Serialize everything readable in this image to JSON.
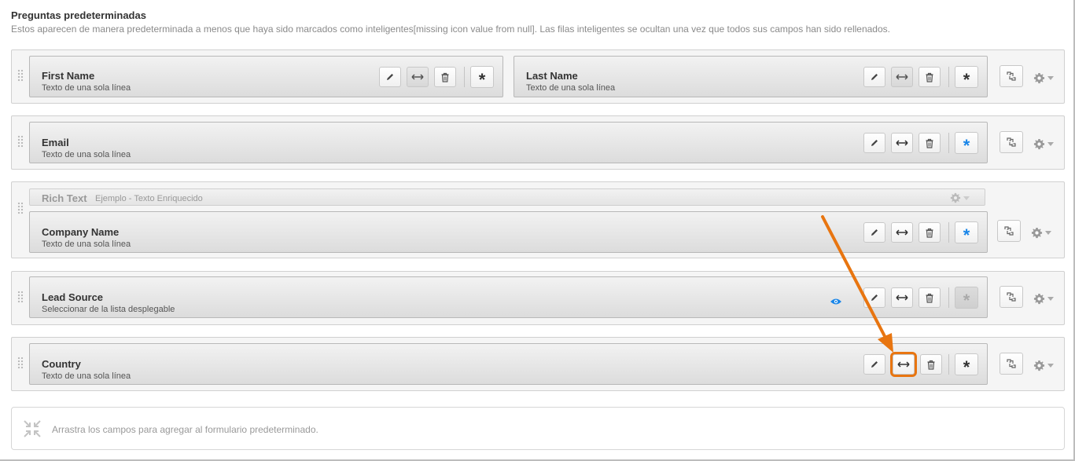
{
  "section": {
    "title": "Preguntas predeterminadas",
    "description": "Estos aparecen de manera predeterminada a menos que haya sido marcados como inteligentes[missing icon value from null]. Las filas inteligentes se ocultan una vez que todos sus campos han sido rellenados."
  },
  "rows": [
    {
      "fields": [
        {
          "name": "First Name",
          "type": "Texto de una sola línea",
          "required": "dark"
        },
        {
          "name": "Last Name",
          "type": "Texto de una sola línea",
          "required": "dark"
        }
      ]
    },
    {
      "fields": [
        {
          "name": "Email",
          "type": "Texto de una sola línea",
          "required": "blue"
        }
      ]
    },
    {
      "rich_text": {
        "title": "Rich Text",
        "subtitle": "Ejemplo - Texto Enriquecido"
      },
      "fields": [
        {
          "name": "Company Name",
          "type": "Texto de una sola línea",
          "required": "blue"
        }
      ]
    },
    {
      "fields": [
        {
          "name": "Lead Source",
          "type": "Seleccionar de la lista desplegable",
          "required": "grey",
          "visibility_icon": "eye-icon"
        }
      ]
    },
    {
      "fields": [
        {
          "name": "Country",
          "type": "Texto de una sola línea",
          "required": "dark",
          "highlighted_button": "width-toggle-button"
        }
      ]
    }
  ],
  "drop_zone": {
    "text": "Arrastra los campos para agregar al formulario predeterminado."
  },
  "icons": {
    "edit": "pencil-icon",
    "width": "horizontal-arrows-icon",
    "delete": "trash-icon",
    "required": "asterisk-icon",
    "link": "link-icon",
    "settings": "gear-icon"
  },
  "colors": {
    "required_active": "#1a86e8",
    "annotation": "#e87510",
    "eye": "#1a86e8"
  }
}
